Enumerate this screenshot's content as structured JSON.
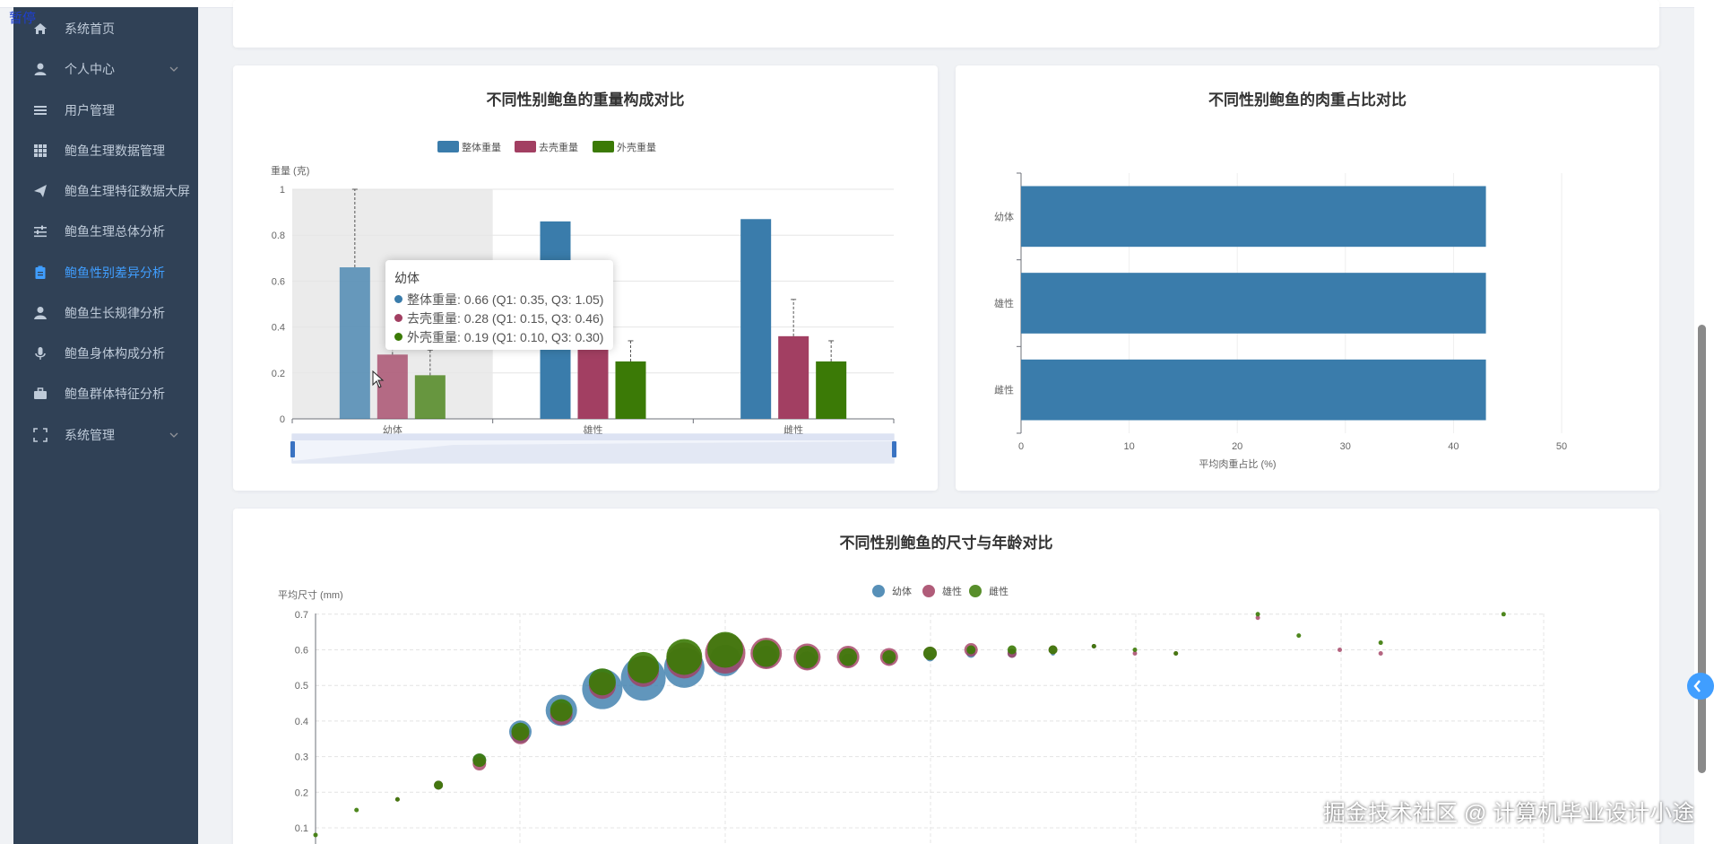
{
  "overlay": {
    "paused": "暂停",
    "watermark": "掘金技术社区 @ 计算机毕业设计小途"
  },
  "sidebar": {
    "items": [
      {
        "label": "系统首页",
        "icon": "home-icon",
        "active": false
      },
      {
        "label": "个人中心",
        "icon": "user-icon",
        "active": false,
        "expandable": true
      },
      {
        "label": "用户管理",
        "icon": "list-icon",
        "active": false
      },
      {
        "label": "鲍鱼生理数据管理",
        "icon": "grid-icon",
        "active": false
      },
      {
        "label": "鲍鱼生理特征数据大屏",
        "icon": "send-icon",
        "active": false
      },
      {
        "label": "鲍鱼生理总体分析",
        "icon": "sliders-icon",
        "active": false
      },
      {
        "label": "鲍鱼性别差异分析",
        "icon": "clipboard-icon",
        "active": true
      },
      {
        "label": "鲍鱼生长规律分析",
        "icon": "person-icon",
        "active": false
      },
      {
        "label": "鲍鱼身体构成分析",
        "icon": "mic-icon",
        "active": false
      },
      {
        "label": "鲍鱼群体特征分析",
        "icon": "briefcase-icon",
        "active": false
      },
      {
        "label": "系统管理",
        "icon": "fullscreen-icon",
        "active": false,
        "expandable": true
      }
    ]
  },
  "colors": {
    "blue": "#3a7cab",
    "red": "#a23f62",
    "green": "#3b7a06",
    "active": "#409eff",
    "sidebar": "#304156"
  },
  "chart_data": [
    {
      "type": "bar",
      "title": "不同性别鲍鱼的重量构成对比",
      "ylabel": "重量 (克)",
      "ylim": [
        0,
        1
      ],
      "yticks": [
        "0",
        "0.2",
        "0.4",
        "0.6",
        "0.8",
        "1"
      ],
      "categories": [
        "幼体",
        "雄性",
        "雌性"
      ],
      "series": [
        {
          "name": "整体重量",
          "values": [
            0.66,
            0.86,
            0.87
          ]
        },
        {
          "name": "去壳重量",
          "values": [
            0.28,
            0.32,
            0.36
          ]
        },
        {
          "name": "外壳重量",
          "values": [
            0.19,
            0.25,
            0.25
          ]
        }
      ],
      "error_tops": [
        [
          1.05,
          null,
          null
        ],
        [
          0.46,
          null,
          0.52
        ],
        [
          0.3,
          0.34,
          0.34
        ]
      ],
      "legend": "top-center",
      "highlighted_category": "幼体",
      "tooltip": {
        "title": "幼体",
        "rows": [
          "整体重量: 0.66 (Q1: 0.35, Q3: 1.05)",
          "去壳重量: 0.28 (Q1: 0.15, Q3: 0.46)",
          "外壳重量: 0.19 (Q1: 0.10, Q3: 0.30)"
        ]
      },
      "datazoom": true
    },
    {
      "type": "bar",
      "orientation": "horizontal",
      "title": "不同性别鲍鱼的肉重占比对比",
      "xlabel": "平均肉重占比 (%)",
      "xlim": [
        0,
        50
      ],
      "xticks": [
        "0",
        "10",
        "20",
        "30",
        "40",
        "50"
      ],
      "categories": [
        "幼体",
        "雄性",
        "雌性"
      ],
      "values": [
        43,
        43,
        43
      ]
    },
    {
      "type": "scatter",
      "title": "不同性别鲍鱼的尺寸与年龄对比",
      "ylabel": "平均尺寸 (mm)",
      "yticks": [
        "0.1",
        "0.2",
        "0.3",
        "0.4",
        "0.5",
        "0.6",
        "0.7"
      ],
      "legend": "top-center",
      "series": [
        {
          "name": "幼体",
          "points": [
            [
              4,
              0.22,
              2
            ],
            [
              5,
              0.29,
              3
            ],
            [
              6,
              0.37,
              5
            ],
            [
              7,
              0.43,
              7
            ],
            [
              8,
              0.49,
              9
            ],
            [
              9,
              0.52,
              10
            ],
            [
              10,
              0.55,
              9
            ],
            [
              11,
              0.57,
              7
            ],
            [
              12,
              0.58,
              5
            ],
            [
              13,
              0.57,
              4
            ],
            [
              14,
              0.57,
              3
            ],
            [
              15,
              0.57,
              2
            ],
            [
              16,
              0.58,
              2
            ],
            [
              17,
              0.59,
              2
            ],
            [
              18,
              0.59,
              2
            ],
            [
              19,
              0.59,
              1
            ],
            [
              20,
              0.61,
              1
            ]
          ]
        },
        {
          "name": "雄性",
          "points": [
            [
              3,
              0.18,
              1
            ],
            [
              4,
              0.22,
              2
            ],
            [
              5,
              0.28,
              3
            ],
            [
              6,
              0.36,
              4
            ],
            [
              7,
              0.42,
              5
            ],
            [
              8,
              0.5,
              6
            ],
            [
              9,
              0.54,
              7
            ],
            [
              10,
              0.57,
              8
            ],
            [
              11,
              0.59,
              9
            ],
            [
              12,
              0.59,
              7
            ],
            [
              13,
              0.58,
              6
            ],
            [
              14,
              0.58,
              5
            ],
            [
              15,
              0.58,
              4
            ],
            [
              16,
              0.59,
              3
            ],
            [
              17,
              0.6,
              3
            ],
            [
              18,
              0.59,
              2
            ],
            [
              19,
              0.6,
              2
            ],
            [
              20,
              0.61,
              1
            ],
            [
              21,
              0.59,
              1
            ],
            [
              22,
              0.59,
              1
            ],
            [
              24,
              0.69,
              1
            ],
            [
              26,
              0.6,
              1
            ],
            [
              27,
              0.59,
              1
            ]
          ]
        },
        {
          "name": "雌性",
          "points": [
            [
              1,
              0.08,
              1
            ],
            [
              2,
              0.15,
              1
            ],
            [
              3,
              0.18,
              1
            ],
            [
              4,
              0.22,
              2
            ],
            [
              5,
              0.29,
              3
            ],
            [
              6,
              0.37,
              4
            ],
            [
              7,
              0.43,
              5
            ],
            [
              8,
              0.51,
              6
            ],
            [
              9,
              0.55,
              7
            ],
            [
              10,
              0.58,
              8
            ],
            [
              11,
              0.6,
              8
            ],
            [
              12,
              0.59,
              6
            ],
            [
              13,
              0.58,
              5
            ],
            [
              14,
              0.58,
              4
            ],
            [
              15,
              0.58,
              3
            ],
            [
              16,
              0.59,
              3
            ],
            [
              17,
              0.6,
              2
            ],
            [
              18,
              0.6,
              2
            ],
            [
              19,
              0.6,
              2
            ],
            [
              20,
              0.61,
              1
            ],
            [
              21,
              0.6,
              1
            ],
            [
              22,
              0.59,
              1
            ],
            [
              24,
              0.7,
              1
            ],
            [
              25,
              0.64,
              1
            ],
            [
              27,
              0.62,
              1
            ],
            [
              30,
              0.7,
              1
            ]
          ]
        }
      ]
    }
  ]
}
